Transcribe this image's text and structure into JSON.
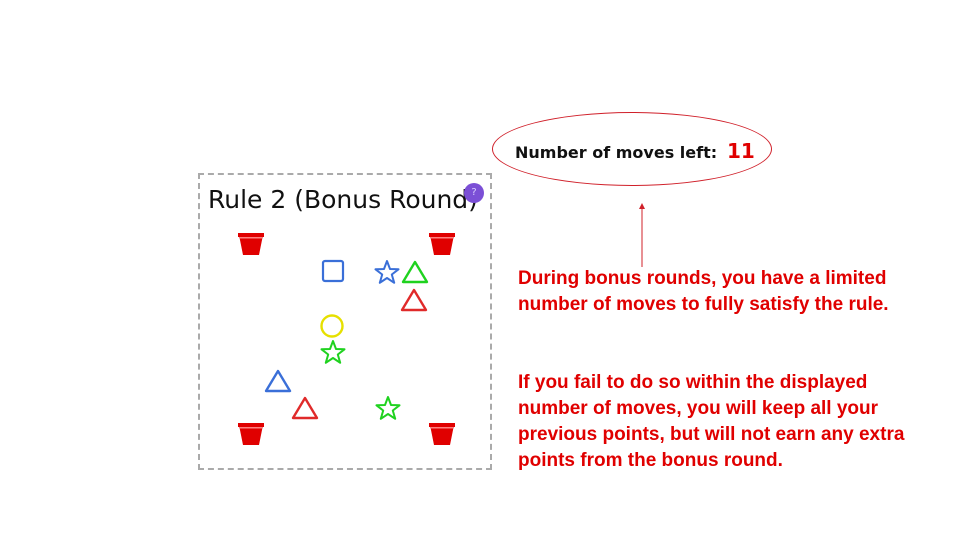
{
  "board": {
    "title": "Rule 2 (Bonus Round)",
    "help_badge": "?",
    "buckets": [
      "red-bucket",
      "red-bucket",
      "red-bucket",
      "red-bucket"
    ],
    "pieces": [
      {
        "shape": "square",
        "color": "#3a6fd8"
      },
      {
        "shape": "star",
        "color": "#3a6fd8"
      },
      {
        "shape": "triangle",
        "color": "#1fd21f"
      },
      {
        "shape": "triangle",
        "color": "#e02a2a"
      },
      {
        "shape": "circle",
        "color": "#e6e000"
      },
      {
        "shape": "star",
        "color": "#1fd21f"
      },
      {
        "shape": "triangle",
        "color": "#3a6fd8"
      },
      {
        "shape": "triangle",
        "color": "#e02a2a"
      },
      {
        "shape": "star",
        "color": "#1fd21f"
      }
    ]
  },
  "moves": {
    "label": "Number of moves left:",
    "count": "11"
  },
  "notes": {
    "line1": "During bonus rounds, you have a limited number of moves to fully satisfy the rule.",
    "line2": "If you fail to do so within the displayed number of moves, you will keep all your previous points, but will not earn any extra points from the bonus round."
  },
  "colors": {
    "accent": "#e00000",
    "bucket": "#e00000",
    "badge": "#7b4fd6"
  }
}
